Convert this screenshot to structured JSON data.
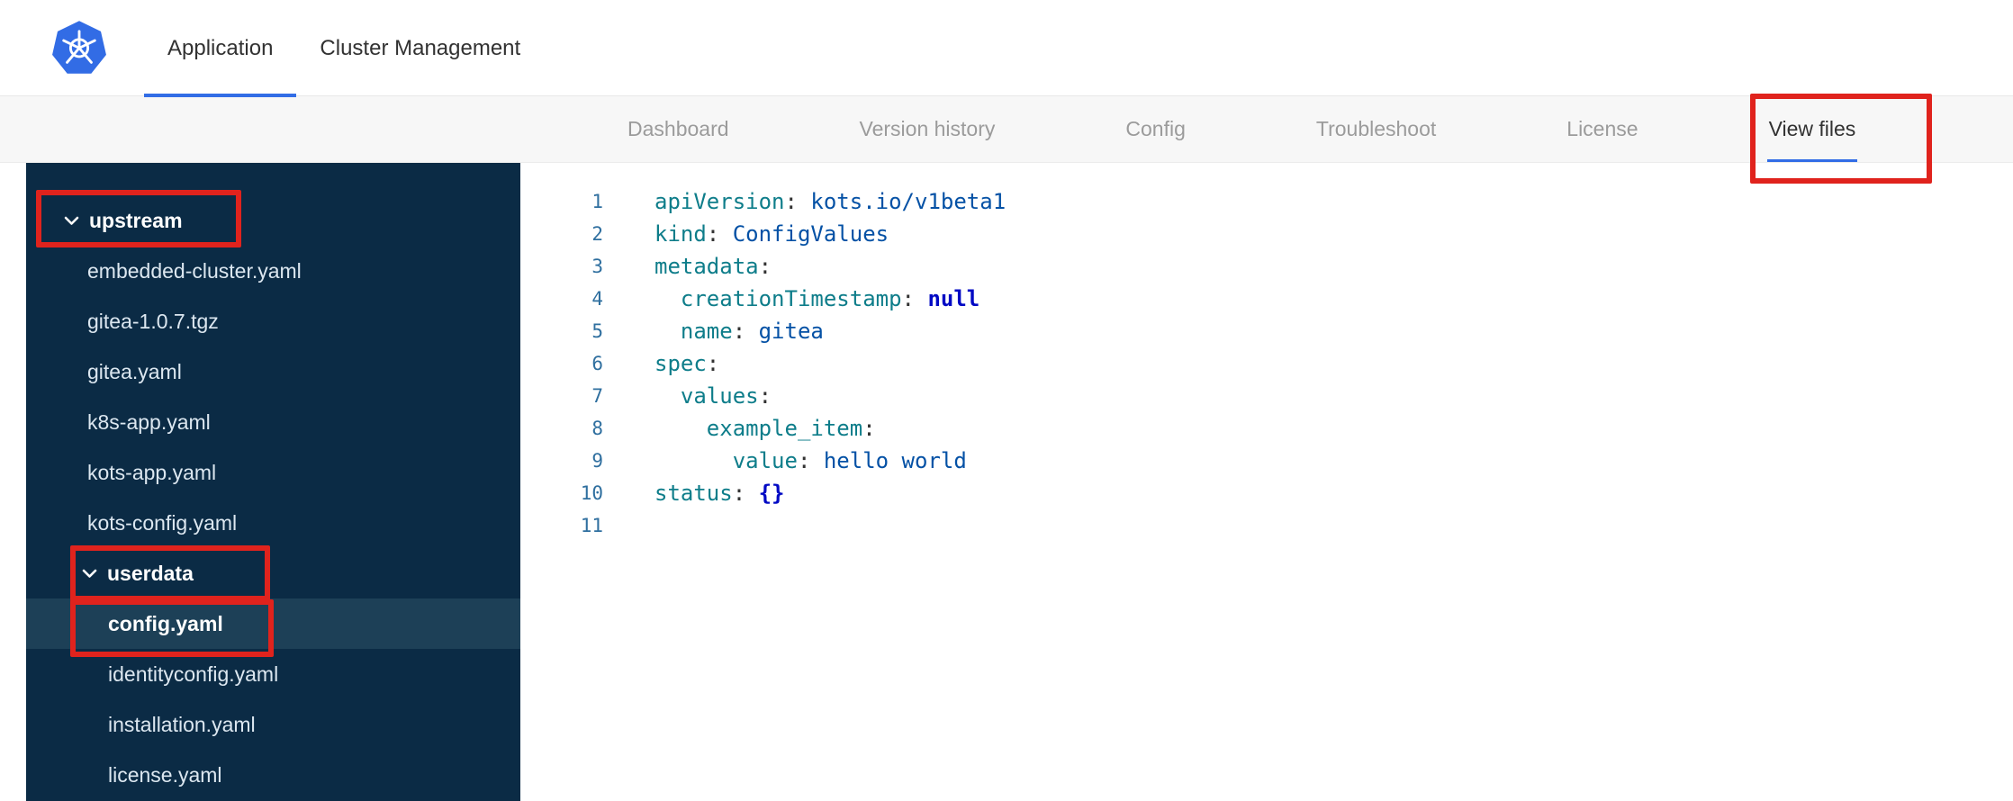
{
  "colors": {
    "accent_blue": "#326de6",
    "annotation_red": "#e0231d",
    "sidebar_bg": "#0b2b45",
    "sidebar_selected_bg": "#1d4057"
  },
  "topbar": {
    "tabs": [
      {
        "label": "Application",
        "active": true
      },
      {
        "label": "Cluster Management",
        "active": false
      }
    ]
  },
  "subnav": {
    "items": [
      {
        "label": "Dashboard",
        "active": false
      },
      {
        "label": "Version history",
        "active": false
      },
      {
        "label": "Config",
        "active": false
      },
      {
        "label": "Troubleshoot",
        "active": false
      },
      {
        "label": "License",
        "active": false
      },
      {
        "label": "View files",
        "active": true
      }
    ]
  },
  "file_tree": {
    "items": [
      {
        "label": "upstream",
        "type": "folder",
        "level": 0,
        "expanded": true,
        "selected": false
      },
      {
        "label": "embedded-cluster.yaml",
        "type": "file",
        "level": 1,
        "selected": false
      },
      {
        "label": "gitea-1.0.7.tgz",
        "type": "file",
        "level": 1,
        "selected": false
      },
      {
        "label": "gitea.yaml",
        "type": "file",
        "level": 1,
        "selected": false
      },
      {
        "label": "k8s-app.yaml",
        "type": "file",
        "level": 1,
        "selected": false
      },
      {
        "label": "kots-app.yaml",
        "type": "file",
        "level": 1,
        "selected": false
      },
      {
        "label": "kots-config.yaml",
        "type": "file",
        "level": 1,
        "selected": false
      },
      {
        "label": "userdata",
        "type": "folder",
        "level": 1,
        "expanded": true,
        "selected": false
      },
      {
        "label": "config.yaml",
        "type": "file",
        "level": 2,
        "selected": true
      },
      {
        "label": "identityconfig.yaml",
        "type": "file",
        "level": 2,
        "selected": false
      },
      {
        "label": "installation.yaml",
        "type": "file",
        "level": 2,
        "selected": false
      },
      {
        "label": "license.yaml",
        "type": "file",
        "level": 2,
        "selected": false
      }
    ]
  },
  "editor": {
    "language": "yaml",
    "lines": [
      {
        "n": 1,
        "tokens": [
          {
            "t": "key",
            "s": "apiVersion"
          },
          {
            "t": "punct",
            "s": ": "
          },
          {
            "t": "val",
            "s": "kots.io/v1beta1"
          }
        ]
      },
      {
        "n": 2,
        "tokens": [
          {
            "t": "key",
            "s": "kind"
          },
          {
            "t": "punct",
            "s": ": "
          },
          {
            "t": "val",
            "s": "ConfigValues"
          }
        ]
      },
      {
        "n": 3,
        "tokens": [
          {
            "t": "key",
            "s": "metadata"
          },
          {
            "t": "punct",
            "s": ":"
          }
        ]
      },
      {
        "n": 4,
        "tokens": [
          {
            "t": "plain",
            "s": "  "
          },
          {
            "t": "key",
            "s": "creationTimestamp"
          },
          {
            "t": "punct",
            "s": ": "
          },
          {
            "t": "kw",
            "s": "null"
          }
        ]
      },
      {
        "n": 5,
        "tokens": [
          {
            "t": "plain",
            "s": "  "
          },
          {
            "t": "key",
            "s": "name"
          },
          {
            "t": "punct",
            "s": ": "
          },
          {
            "t": "val",
            "s": "gitea"
          }
        ]
      },
      {
        "n": 6,
        "tokens": [
          {
            "t": "key",
            "s": "spec"
          },
          {
            "t": "punct",
            "s": ":"
          }
        ]
      },
      {
        "n": 7,
        "tokens": [
          {
            "t": "plain",
            "s": "  "
          },
          {
            "t": "key",
            "s": "values"
          },
          {
            "t": "punct",
            "s": ":"
          }
        ]
      },
      {
        "n": 8,
        "tokens": [
          {
            "t": "plain",
            "s": "    "
          },
          {
            "t": "key",
            "s": "example_item"
          },
          {
            "t": "punct",
            "s": ":"
          }
        ]
      },
      {
        "n": 9,
        "tokens": [
          {
            "t": "plain",
            "s": "      "
          },
          {
            "t": "key",
            "s": "value"
          },
          {
            "t": "punct",
            "s": ": "
          },
          {
            "t": "val",
            "s": "hello world"
          }
        ]
      },
      {
        "n": 10,
        "tokens": [
          {
            "t": "key",
            "s": "status"
          },
          {
            "t": "punct",
            "s": ": "
          },
          {
            "t": "kw",
            "s": "{}"
          }
        ]
      },
      {
        "n": 11,
        "tokens": []
      }
    ]
  },
  "annotations": [
    {
      "target": "view-files-tab"
    },
    {
      "target": "upstream-folder"
    },
    {
      "target": "userdata-folder"
    },
    {
      "target": "config-yaml-file"
    }
  ]
}
